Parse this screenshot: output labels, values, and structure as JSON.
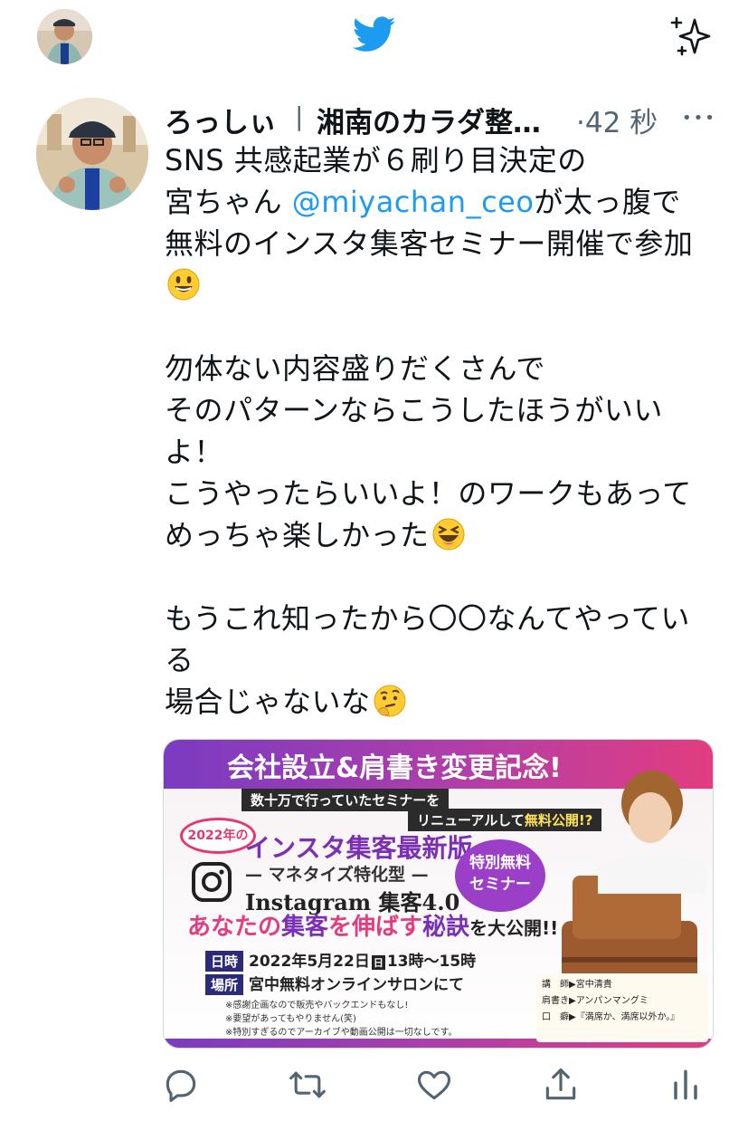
{
  "tweet": {
    "author_name": "ろっしぃ",
    "author_sep": "|",
    "author_suffix": "湘南のカラダ整…",
    "dot": "·",
    "time": "42 秒",
    "more": "•••",
    "lines": [
      "SNS 共感起業が６刷り目決定の",
      "宮ちゃん ",
      "@miyachan_ceo",
      "が太っ腹で",
      "無料のインスタ集客セミナー開催で参加",
      "勿体ない内容盛りだくさんで",
      "そのパターンならこうしたほうがいい",
      "よ！",
      "こうやったらいいよ！のワークもあって",
      "めっちゃ楽しかった",
      "もうこれ知ったから〇〇なんてやってい",
      "る",
      "場合じゃないな"
    ]
  },
  "media": {
    "title": "会社設立&肩書き変更記念!",
    "sub1": "数十万で行っていたセミナーを",
    "sub2_a": "リニューアルして",
    "sub2_b": "無料公開!?",
    "year_oval": "2022年の",
    "headline": "インスタ集客最新版",
    "mtype": "— マネタイズ特化型 —",
    "instagram": "Instagram 集客4.0",
    "badge_line1": "特別無料",
    "badge_line2": "セミナー",
    "big_a": "あなたの",
    "big_b": "集客",
    "big_c": "を伸ばす",
    "big_d": "秘訣",
    "big_e": "を大公開!!",
    "date_tag": "日時",
    "date": "2022年5月22日",
    "date_day": "日",
    "date_time": "13時〜15時",
    "place_tag": "場所",
    "place": "宮中無料オンラインサロンにて",
    "notes": [
      "※感謝企画なので販売やバックエンドもなし!",
      "※要望があってもやりません(笑)",
      "※特別すぎるのでアーカイブや動画公開は一切なしです。"
    ],
    "info": [
      "講　師▶宮中清貴",
      "肩書き▶アンパンマングミ",
      "口　癖▶『満席か、満席以外か。』"
    ]
  },
  "colors": {
    "accent": "#1d9bf0",
    "text": "#0f1419",
    "secondary": "#536471",
    "banner_purple": "#8a3fc6",
    "banner_pink": "#e23d7f"
  },
  "icons": {
    "top_left": "user-avatar",
    "logo": "twitter-bird-icon",
    "top_right": "sparkle-icon",
    "actions": [
      "reply-icon",
      "retweet-icon",
      "like-icon",
      "share-icon",
      "analytics-icon"
    ]
  }
}
